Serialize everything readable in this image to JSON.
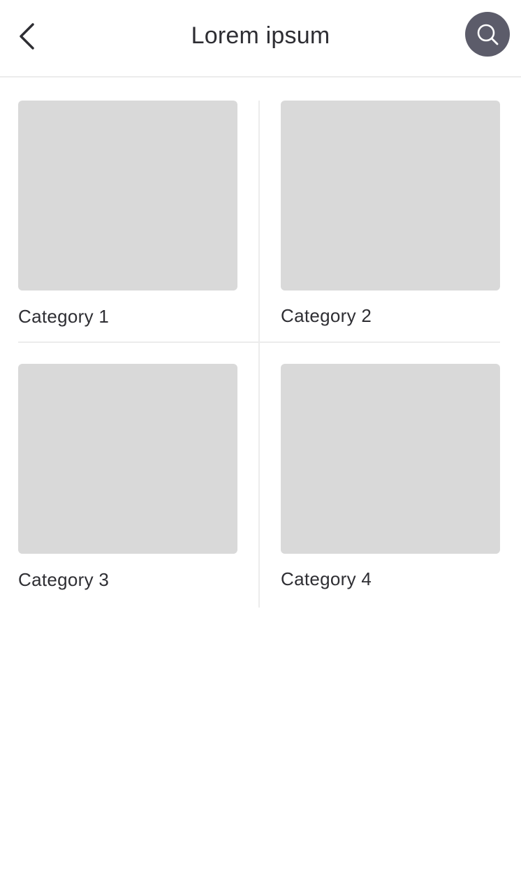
{
  "header": {
    "title": "Lorem ipsum",
    "back_icon": "chevron-left-icon",
    "search_icon": "search-icon",
    "search_button_color": "#5c5c6a"
  },
  "categories": [
    {
      "label": "Category 1"
    },
    {
      "label": "Category 2"
    },
    {
      "label": "Category 3"
    },
    {
      "label": "Category 4"
    }
  ],
  "colors": {
    "placeholder": "#d9d9d9",
    "divider": "#ececec",
    "text": "#2e2e33"
  }
}
